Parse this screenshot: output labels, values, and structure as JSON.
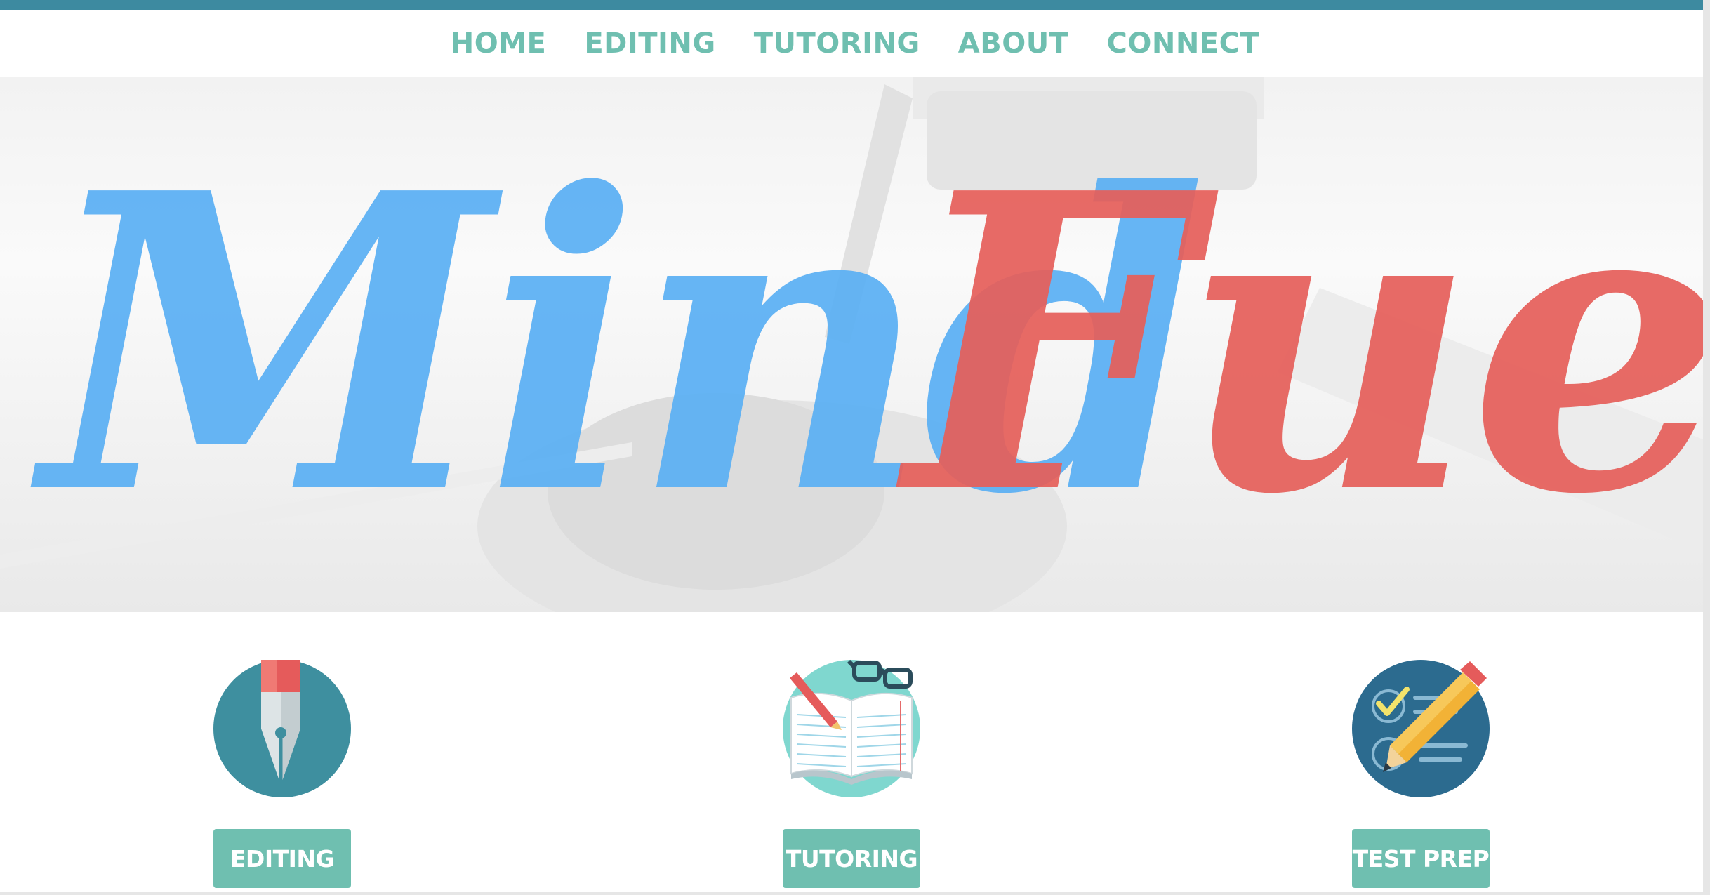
{
  "nav": {
    "items": [
      "HOME",
      "EDITING",
      "TUTORING",
      "ABOUT",
      "CONNECT"
    ]
  },
  "hero": {
    "brand_part1": "Mind",
    "brand_part2": "Fuel"
  },
  "services": [
    {
      "label": "EDITING",
      "icon": "fountain-pen-icon"
    },
    {
      "label": "TUTORING",
      "icon": "open-book-icon"
    },
    {
      "label": "TEST PREP",
      "icon": "checklist-pencil-icon"
    }
  ],
  "colors": {
    "top_strip": "#3d8aa0",
    "nav_text": "#6fbfb0",
    "brand_blue": "#5bb0f4",
    "brand_red": "#e6605b",
    "button_bg": "#6fbfb0",
    "icon_teal": "#3e8f9f",
    "icon_mint": "#7fd7cf",
    "icon_navy": "#2c6b8f"
  }
}
